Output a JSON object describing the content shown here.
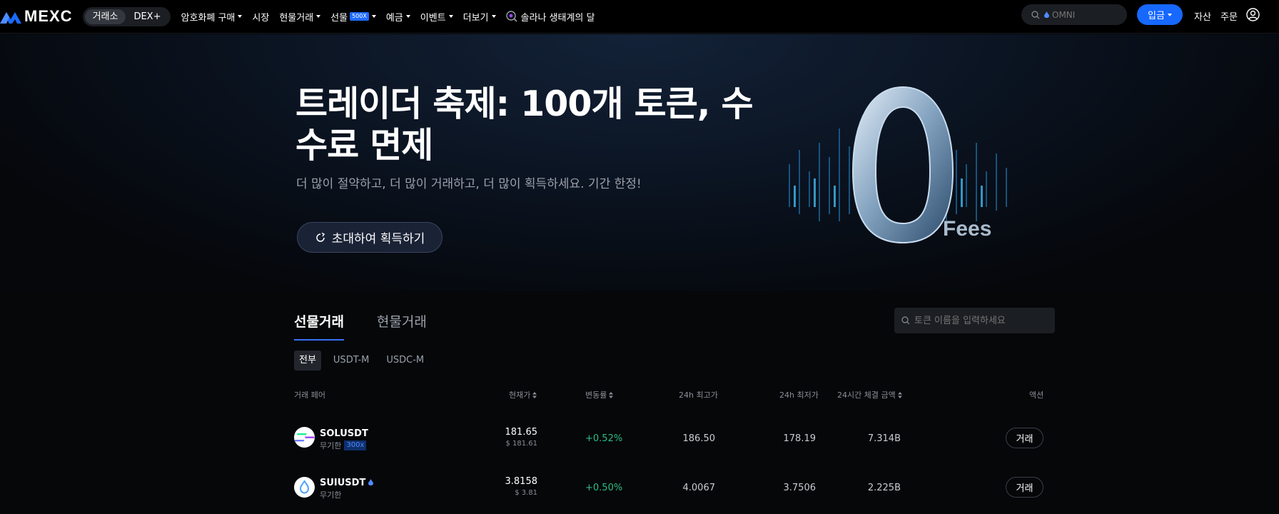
{
  "header": {
    "logo_text": "MEXC",
    "segment": [
      "거래소",
      "DEX+"
    ],
    "nav": [
      {
        "label": "암호화폐 구매",
        "dropdown": true
      },
      {
        "label": "시장",
        "dropdown": false
      },
      {
        "label": "현물거래",
        "dropdown": true
      },
      {
        "label": "선물",
        "dropdown": true,
        "badge": "500X"
      },
      {
        "label": "예금",
        "dropdown": true
      },
      {
        "label": "이벤트",
        "dropdown": true
      },
      {
        "label": "더보기",
        "dropdown": true
      },
      {
        "label": "솔라나 생태계의 달",
        "dropdown": false
      }
    ],
    "search_placeholder": "OMNI",
    "deposit_label": "입금",
    "asset_label": "자산",
    "orders_label": "주문"
  },
  "hero": {
    "title": "트레이더 축제: 100개 토큰, 수수료 면제",
    "subtitle": "더 많이 절약하고, 더 많이 거래하고, 더 많이 획득하세요. 기간 한정!",
    "cta_label": "초대하여 획득하기",
    "art_text": "Fees"
  },
  "market": {
    "tabs": [
      "선물거래",
      "현물거래"
    ],
    "search_placeholder": "토큰 이름을 입력하세요",
    "filters": [
      "전부",
      "USDT-M",
      "USDC-M"
    ],
    "columns": {
      "pair": "거래 페어",
      "price": "현재가",
      "change": "변동률",
      "high": "24h 최고가",
      "low": "24h 최저가",
      "volume": "24시간 체결 금액",
      "action": "액션"
    },
    "rows": [
      {
        "symbol": "SOLUSDT",
        "type": "무기한",
        "leverage": "300x",
        "price": "181.65",
        "price_usd": "$ 181.61",
        "change": "+0.52%",
        "high": "186.50",
        "low": "178.19",
        "volume": "7.314B",
        "action": "거래"
      },
      {
        "symbol": "SUIUSDT",
        "type": "무기한",
        "leverage": "",
        "price": "3.8158",
        "price_usd": "$ 3.81",
        "change": "+0.50%",
        "high": "4.0067",
        "low": "3.7506",
        "volume": "2.225B",
        "action": "거래"
      }
    ]
  }
}
